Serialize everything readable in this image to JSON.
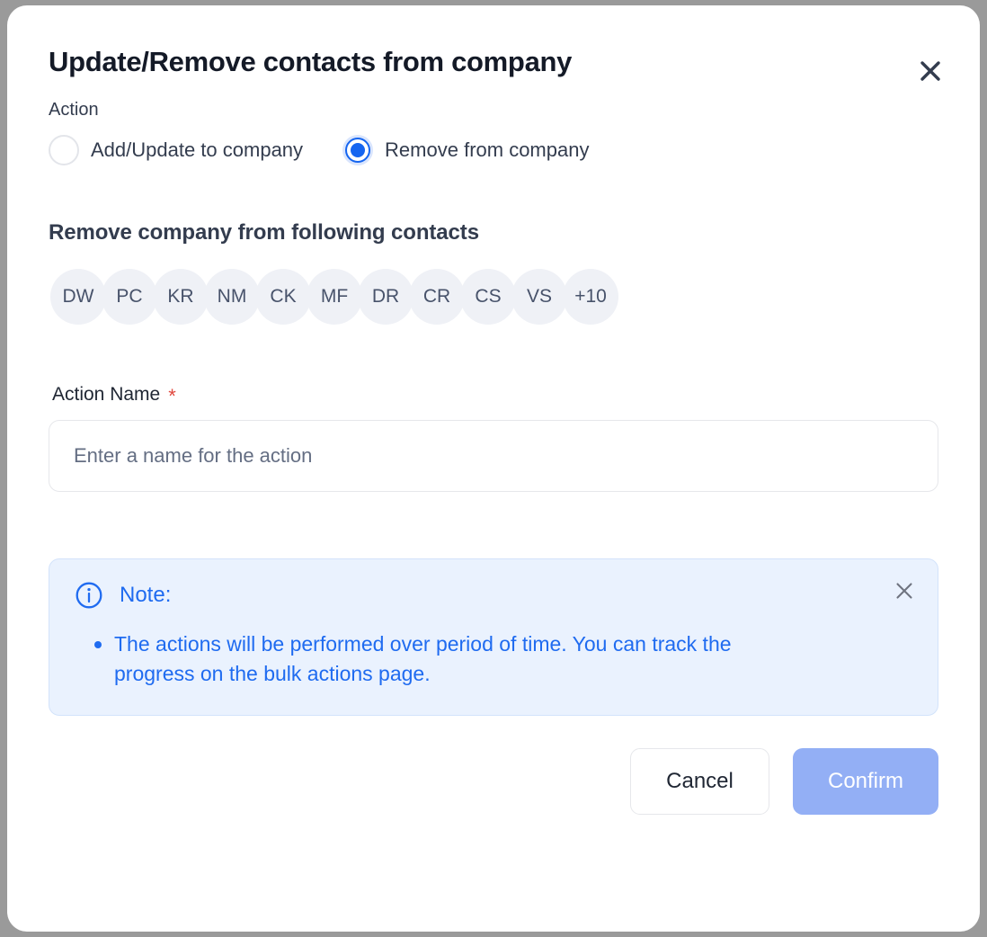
{
  "dialog": {
    "title": "Update/Remove contacts from company",
    "close_icon": "close-icon"
  },
  "action_section": {
    "label": "Action",
    "options": [
      {
        "label": "Add/Update to company",
        "selected": false
      },
      {
        "label": "Remove from company",
        "selected": true
      }
    ]
  },
  "contacts_section": {
    "heading": "Remove company from following contacts",
    "avatars": [
      {
        "initials": "DW"
      },
      {
        "initials": "PC"
      },
      {
        "initials": "KR"
      },
      {
        "initials": "NM"
      },
      {
        "initials": "CK"
      },
      {
        "initials": "MF"
      },
      {
        "initials": "DR"
      },
      {
        "initials": "CR"
      },
      {
        "initials": "CS"
      },
      {
        "initials": "VS"
      }
    ],
    "overflow_label": "+10"
  },
  "action_name": {
    "label": "Action Name",
    "required_marker": "*",
    "value": "",
    "placeholder": "Enter a name for the action"
  },
  "note": {
    "icon": "info-circle-icon",
    "title": "Note:",
    "close_icon": "close-icon",
    "items": [
      "The actions will be performed over period of time. You can track the progress on the bulk actions page."
    ]
  },
  "footer": {
    "cancel_label": "Cancel",
    "confirm_label": "Confirm"
  },
  "colors": {
    "accent_blue": "#1565f0",
    "note_text": "#1f6bf0",
    "note_bg": "#eaf2fe",
    "confirm_bg": "#93aff5",
    "required_star": "#e0473d",
    "avatar_bg": "#eff1f6",
    "title_text": "#141a27"
  }
}
